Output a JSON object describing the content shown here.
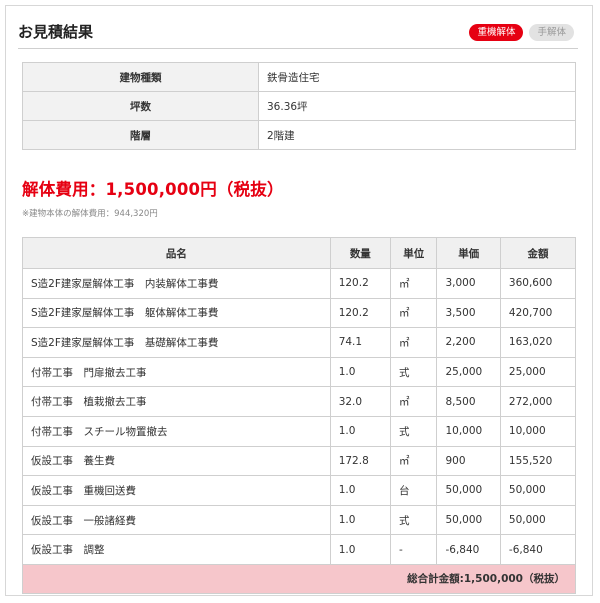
{
  "header": {
    "title": "お見積結果",
    "badge_active": "重機解体",
    "badge_inactive": "手解体"
  },
  "info": [
    {
      "label": "建物種類",
      "value": "鉄骨造住宅"
    },
    {
      "label": "坪数",
      "value": "36.36坪"
    },
    {
      "label": "階層",
      "value": "2階建"
    }
  ],
  "cost": {
    "text": "解体費用：1,500,000円（税抜）",
    "note": "※建物本体の解体費用：944,320円"
  },
  "table": {
    "headers": [
      "品名",
      "数量",
      "単位",
      "単価",
      "金額"
    ],
    "rows": [
      [
        "S造2F建家屋解体工事　内装解体工事費",
        "120.2",
        "㎡",
        "3,000",
        "360,600"
      ],
      [
        "S造2F建家屋解体工事　躯体解体工事費",
        "120.2",
        "㎡",
        "3,500",
        "420,700"
      ],
      [
        "S造2F建家屋解体工事　基礎解体工事費",
        "74.1",
        "㎡",
        "2,200",
        "163,020"
      ],
      [
        "付帯工事　門扉撤去工事",
        "1.0",
        "式",
        "25,000",
        "25,000"
      ],
      [
        "付帯工事　植栽撤去工事",
        "32.0",
        "㎡",
        "8,500",
        "272,000"
      ],
      [
        "付帯工事　スチール物置撤去",
        "1.0",
        "式",
        "10,000",
        "10,000"
      ],
      [
        "仮設工事　養生費",
        "172.8",
        "㎡",
        "900",
        "155,520"
      ],
      [
        "仮設工事　重機回送費",
        "1.0",
        "台",
        "50,000",
        "50,000"
      ],
      [
        "仮設工事　一般諸経費",
        "1.0",
        "式",
        "50,000",
        "50,000"
      ],
      [
        "仮設工事　調整",
        "1.0",
        "-",
        "-6,840",
        "-6,840"
      ]
    ],
    "total": "総合計金額:1,500,000（税抜）"
  },
  "colors": {
    "accent": "#e60012",
    "total_bg": "#f6c6cb",
    "header_bg": "#f0f0f0"
  }
}
